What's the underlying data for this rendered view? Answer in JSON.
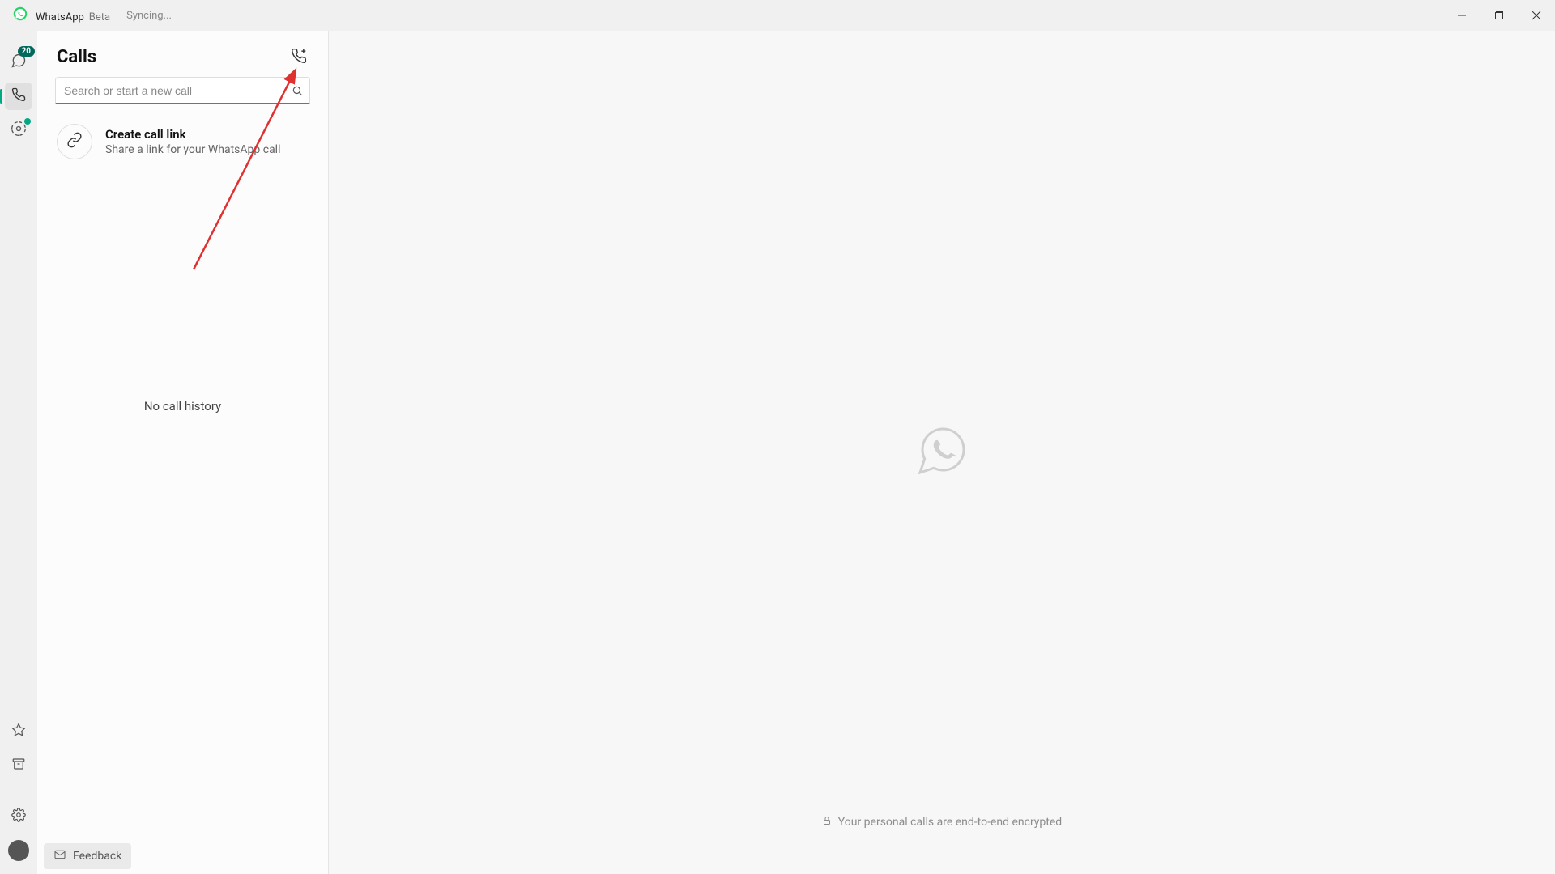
{
  "titlebar": {
    "app_name": "WhatsApp",
    "beta_label": "Beta",
    "sync_status": "Syncing..."
  },
  "nav": {
    "chats_badge": "20"
  },
  "panel": {
    "title": "Calls",
    "search_placeholder": "Search or start a new call",
    "create_link_title": "Create call link",
    "create_link_sub": "Share a link for your WhatsApp call",
    "empty_label": "No call history"
  },
  "feedback": {
    "label": "Feedback"
  },
  "main": {
    "encrypted_text": "Your personal calls are end-to-end encrypted"
  }
}
